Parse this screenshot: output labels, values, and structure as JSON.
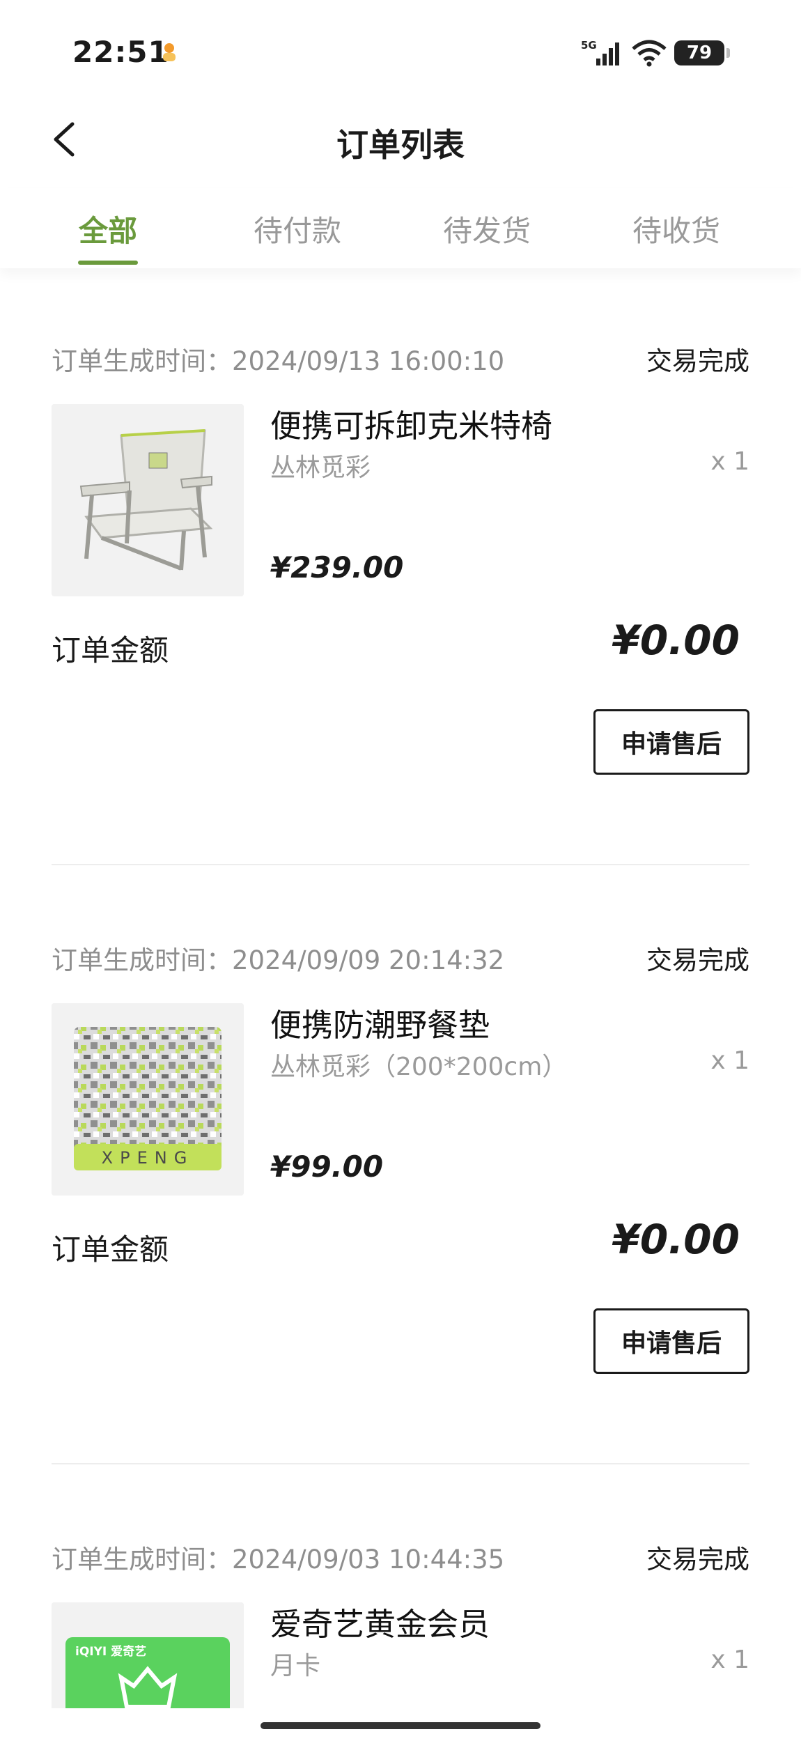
{
  "status_bar": {
    "time": "22:51",
    "network": "5G",
    "battery": "79",
    "icons": [
      "signal-icon",
      "wifi-icon",
      "battery-icon"
    ]
  },
  "nav": {
    "title": "订单列表",
    "back_icon": "chevron-left-icon"
  },
  "tabs": [
    {
      "label": "全部",
      "active": true
    },
    {
      "label": "待付款",
      "active": false
    },
    {
      "label": "待发货",
      "active": false
    },
    {
      "label": "待收货",
      "active": false
    }
  ],
  "orders": [
    {
      "time": "订单生成时间：2024/09/13 16:00:10",
      "status": "交易完成",
      "product": {
        "name": "便携可拆卸克米特椅",
        "spec": "丛林觅彩",
        "qty": "x 1",
        "price": "¥239.00"
      },
      "amount_label": "订单金额",
      "amount": "¥0.00",
      "action": "申请售后"
    },
    {
      "time": "订单生成时间：2024/09/09 20:14:32",
      "status": "交易完成",
      "product": {
        "name": "便携防潮野餐垫",
        "spec": "丛林觅彩（200*200cm）",
        "qty": "x 1",
        "price": "¥99.00",
        "image_text": "XPENG"
      },
      "amount_label": "订单金额",
      "amount": "¥0.00",
      "action": "申请售后"
    },
    {
      "time": "订单生成时间：2024/09/03 10:44:35",
      "status": "交易完成",
      "product": {
        "name": "爱奇艺黄金会员",
        "spec": "月卡",
        "qty": "x 1",
        "image_text": "iQIYI 爱奇艺"
      }
    }
  ],
  "colors": {
    "accent": "#6a9a3c",
    "muted": "#999999",
    "text": "#1a1a1a"
  }
}
